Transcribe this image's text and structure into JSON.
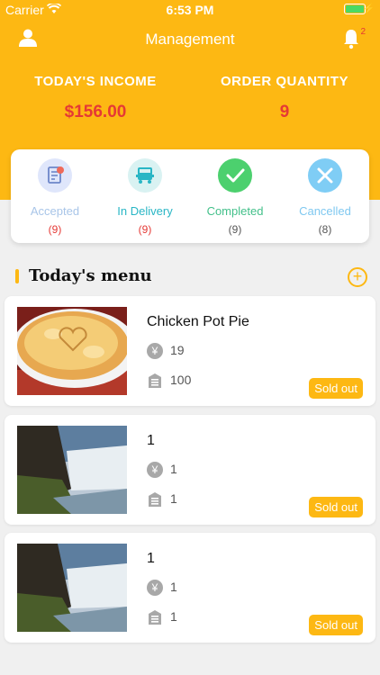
{
  "status_bar": {
    "carrier": "Carrier",
    "time": "6:53 PM"
  },
  "nav": {
    "title": "Management",
    "notification_count": "2"
  },
  "stats": {
    "income_label": "TODAY'S INCOME",
    "income_value": "$156.00",
    "orders_label": "ORDER QUANTITY",
    "orders_value": "9"
  },
  "order_status": [
    {
      "label": "Accepted",
      "count": "(9)",
      "icon": "clipboard-icon",
      "label_color": "#a8c5e8",
      "count_color": "#e53935",
      "bg": "#dfe6fb"
    },
    {
      "label": "In Delivery",
      "count": "(9)",
      "icon": "delivery-truck-icon",
      "label_color": "#29b6c5",
      "count_color": "#e53935",
      "bg": "#d9f2f2"
    },
    {
      "label": "Completed",
      "count": "(9)",
      "icon": "check-icon",
      "label_color": "#43c08a",
      "count_color": "#555555",
      "bg": "#4cd06e"
    },
    {
      "label": "Cancelled",
      "count": "(8)",
      "icon": "close-icon",
      "label_color": "#7fc8f0",
      "count_color": "#555555",
      "bg": "#7fcdf5"
    }
  ],
  "section": {
    "title": "Today's menu"
  },
  "menu": [
    {
      "name": "Chicken Pot Pie",
      "price": "19",
      "stock": "100",
      "status": "Sold out",
      "image": "pie"
    },
    {
      "name": "1",
      "price": "1",
      "stock": "1",
      "status": "Sold out",
      "image": "waterfall"
    },
    {
      "name": "1",
      "price": "1",
      "stock": "1",
      "status": "Sold out",
      "image": "waterfall"
    }
  ],
  "colors": {
    "accent": "#fdb813",
    "danger": "#e53935"
  }
}
